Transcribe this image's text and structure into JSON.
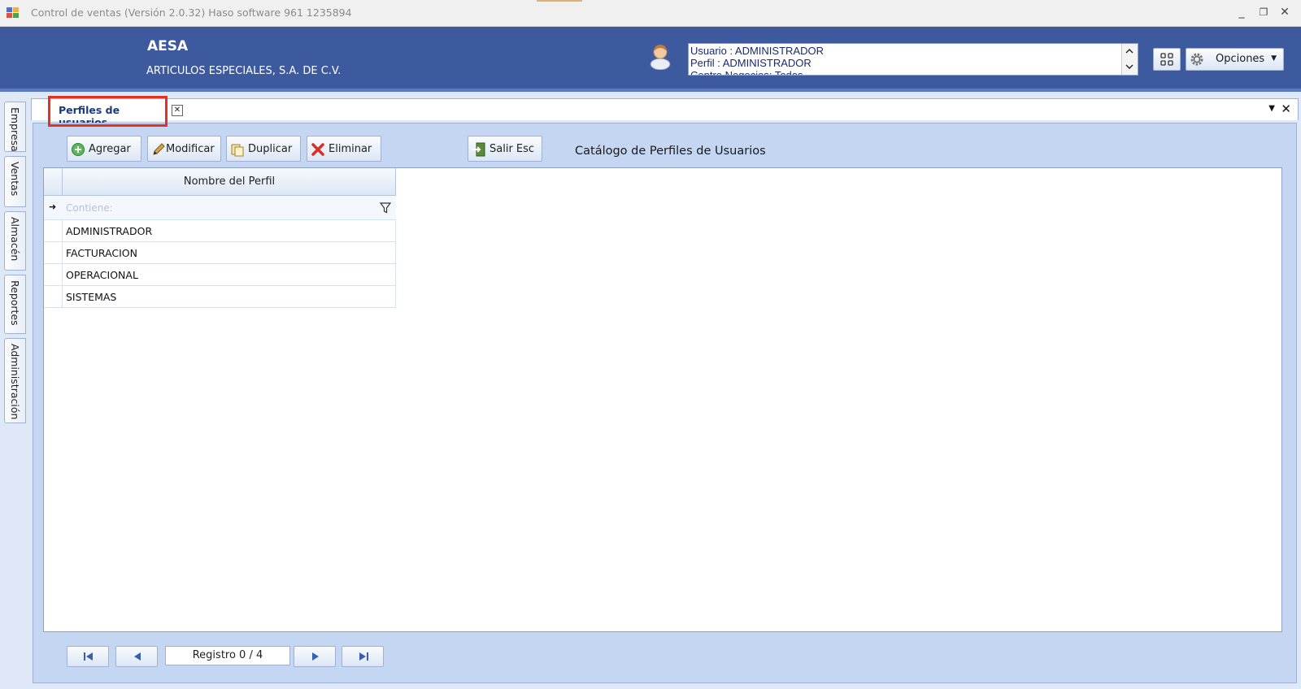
{
  "window": {
    "title": "Control de ventas  (Versión 2.0.32)  Haso software  961 1235894",
    "minimize": "_",
    "restore": "❐",
    "close": "✕"
  },
  "header": {
    "company_code": "AESA",
    "company_name": "ARTICULOS ESPECIALES, S.A. DE C.V.",
    "user_info": [
      "Usuario : ADMINISTRADOR",
      "Perfil : ADMINISTRADOR",
      "Centro Negocios: Todos"
    ],
    "options_label": "Opciones"
  },
  "side_tabs": [
    "Empresa",
    "Ventas",
    "Almacén",
    "Reportes",
    "Administración"
  ],
  "doc_tab": {
    "label": "Perfiles de usuarios",
    "close": "✕"
  },
  "toolbar": {
    "add": "Agregar",
    "modify": "Modificar",
    "duplicate": "Duplicar",
    "delete": "Eliminar",
    "exit": "Salir  Esc"
  },
  "catalog_title": "Catálogo de Perfiles de Usuarios",
  "grid": {
    "column_header": "Nombre del Perfil",
    "filter_placeholder": "Contiene:",
    "rows": [
      "ADMINISTRADOR",
      "FACTURACION",
      "OPERACIONAL",
      "SISTEMAS"
    ]
  },
  "navigator": {
    "record_text": "Registro  0 / 4"
  },
  "colors": {
    "header_blue": "#3e5a9e",
    "highlight_red": "#e13323",
    "panel_blue": "#c4d6f2"
  }
}
